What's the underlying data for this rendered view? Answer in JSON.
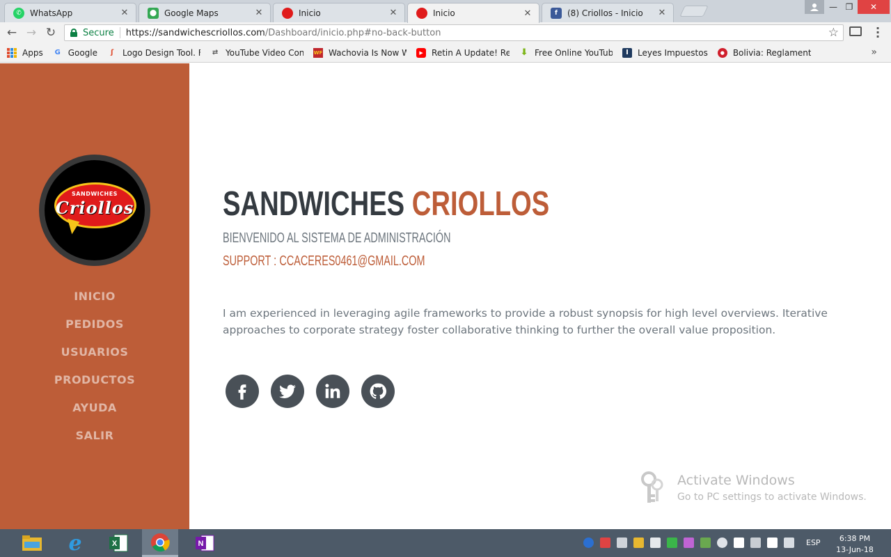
{
  "browser": {
    "tabs": [
      {
        "title": "WhatsApp",
        "icon": "whatsapp-icon",
        "color": "#25d366"
      },
      {
        "title": "Google Maps",
        "icon": "google-maps-icon",
        "color": "#34a853"
      },
      {
        "title": "Inicio",
        "icon": "criollos-favicon-icon",
        "color": "#e01b1b"
      },
      {
        "title": "Inicio",
        "icon": "criollos-favicon-icon",
        "color": "#e01b1b"
      },
      {
        "title": "(8) Criollos - Inicio",
        "icon": "facebook-icon",
        "color": "#3b5998"
      }
    ],
    "active_tab_index": 3,
    "address": {
      "secure_label": "Secure",
      "url_host": "https://sandwichescriollos.com",
      "url_path": "/Dashboard/inicio.php#no-back-button"
    },
    "bookmarks": [
      {
        "label": "Apps",
        "icon": "apps-grid-icon"
      },
      {
        "label": "Google",
        "icon": "google-icon",
        "color": "#4285f4"
      },
      {
        "label": "Logo Design Tool. Fr",
        "icon": "logo-design-icon",
        "color": "#e04b2d"
      },
      {
        "label": "YouTube Video Conv",
        "icon": "convert-icon",
        "color": "#555555"
      },
      {
        "label": "Wachovia Is Now We",
        "icon": "wells-fargo-icon",
        "color": "#c0262c"
      },
      {
        "label": "Retin A Update! Resu",
        "icon": "youtube-icon",
        "color": "#ff0000"
      },
      {
        "label": "Free Online YouTube",
        "icon": "download-icon",
        "color": "#7cb518"
      },
      {
        "label": "Leyes Impuestos",
        "icon": "impuestos-icon",
        "color": "#1f3a5f"
      },
      {
        "label": "Bolivia: Reglamento",
        "icon": "bolivia-icon",
        "color": "#d01f2c"
      }
    ]
  },
  "sidebar": {
    "logo": {
      "top_text": "SANDWICHES",
      "main_text": "Criollos"
    },
    "nav": [
      {
        "label": "INICIO"
      },
      {
        "label": "PEDIDOS"
      },
      {
        "label": "USUARIOS"
      },
      {
        "label": "PRODUCTOS"
      },
      {
        "label": "AYUDA"
      },
      {
        "label": "SALIR"
      }
    ]
  },
  "main": {
    "brand_first": "SANDWICHES",
    "brand_second": "CRIOLLOS",
    "subheading": "BIENVENIDO AL SISTEMA DE ADMINISTRACIÓN",
    "support_label": "SUPPORT :",
    "support_email": "CCACERES0461@GMAIL.COM",
    "intro": "I am experienced in leveraging agile frameworks to provide a robust synopsis for high level overviews. Iterative approaches to corporate strategy foster collaborative thinking to further the overall value proposition.",
    "socials": [
      "facebook-icon",
      "twitter-icon",
      "linkedin-icon",
      "github-icon"
    ]
  },
  "watermark": {
    "title": "Activate Windows",
    "subtitle": "Go to PC settings to activate Windows."
  },
  "taskbar": {
    "apps": [
      "file-explorer-icon",
      "internet-explorer-icon",
      "excel-icon",
      "chrome-icon",
      "onenote-icon"
    ],
    "language": "ESP",
    "time": "6:38 PM",
    "date": "13-Jun-18"
  },
  "colors": {
    "sidebar": "#bd5d38",
    "accent": "#bd5d38",
    "heading": "#343a40",
    "social_bg": "#495057",
    "taskbar": "#4d5a68"
  }
}
